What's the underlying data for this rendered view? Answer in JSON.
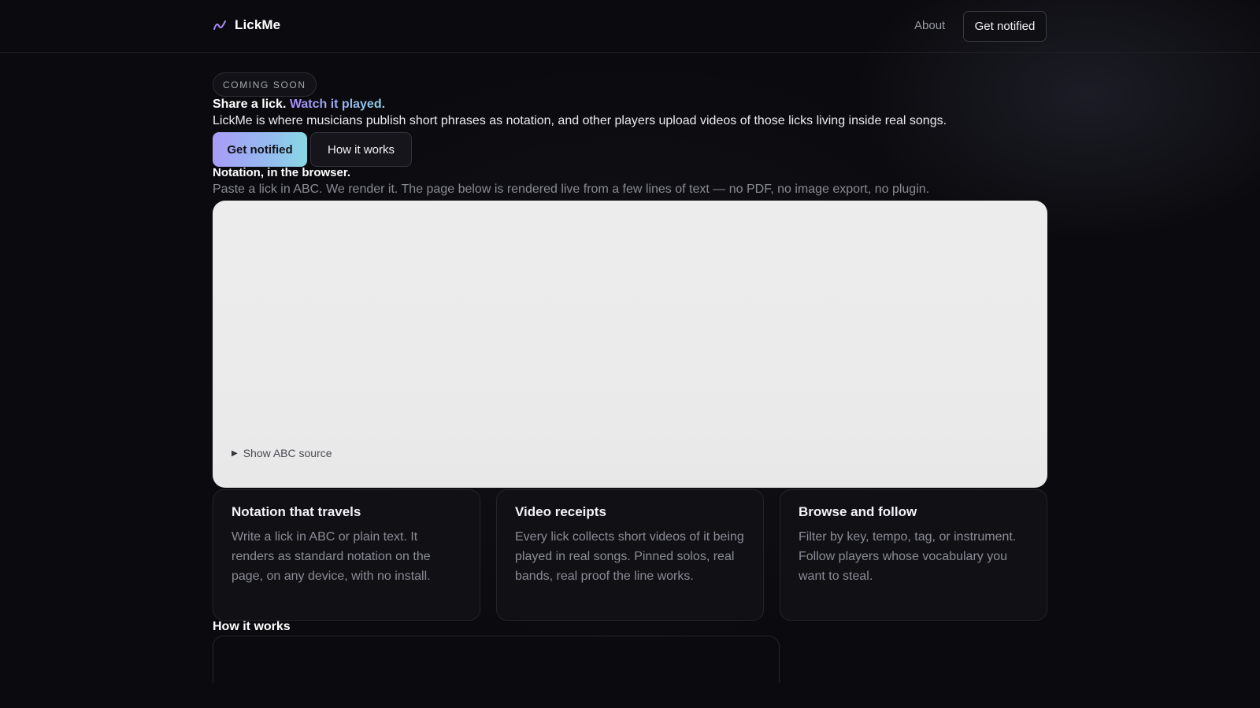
{
  "header": {
    "brand": {
      "name": "LickMe",
      "icon": "squiggle-line-icon",
      "icon_color": "#a78bfa"
    },
    "nav": {
      "about_label": "About",
      "cta_label": "Get notified"
    }
  },
  "hero": {
    "badge": "COMING SOON",
    "headline_lead": "Share a lick.",
    "headline_accent": "Watch it played.",
    "description": "LickMe is where musicians publish short phrases as notation, and other players upload videos of those licks living inside real songs.",
    "primary_cta": "Get notified",
    "secondary_cta": "How it works",
    "accent_gradient": [
      "#a99cf6",
      "#88d8e4"
    ]
  },
  "notation": {
    "title": "Notation, in the browser.",
    "subtitle": "Paste a lick in ABC. We render it. The page below is rendered live from a few lines of text — no PDF, no image export, no plugin.",
    "show_source_label": "Show ABC source",
    "toggle_icon": "disclosure-triangle-icon",
    "panel_color": "#ececec"
  },
  "features": [
    {
      "title": "Notation that travels",
      "body": "Write a lick in ABC or plain text. It renders as standard notation on the page, on any device, with no install."
    },
    {
      "title": "Video receipts",
      "body": "Every lick collects short videos of it being played in real songs. Pinned solos, real bands, real proof the line works."
    },
    {
      "title": "Browse and follow",
      "body": "Filter by key, tempo, tag, or instrument. Follow players whose vocabulary you want to steal."
    }
  ],
  "how_it_works": {
    "title": "How it works"
  },
  "colors": {
    "background": "#0b0b0f",
    "card_background": "#101015",
    "muted_text": "#8c8c97"
  }
}
